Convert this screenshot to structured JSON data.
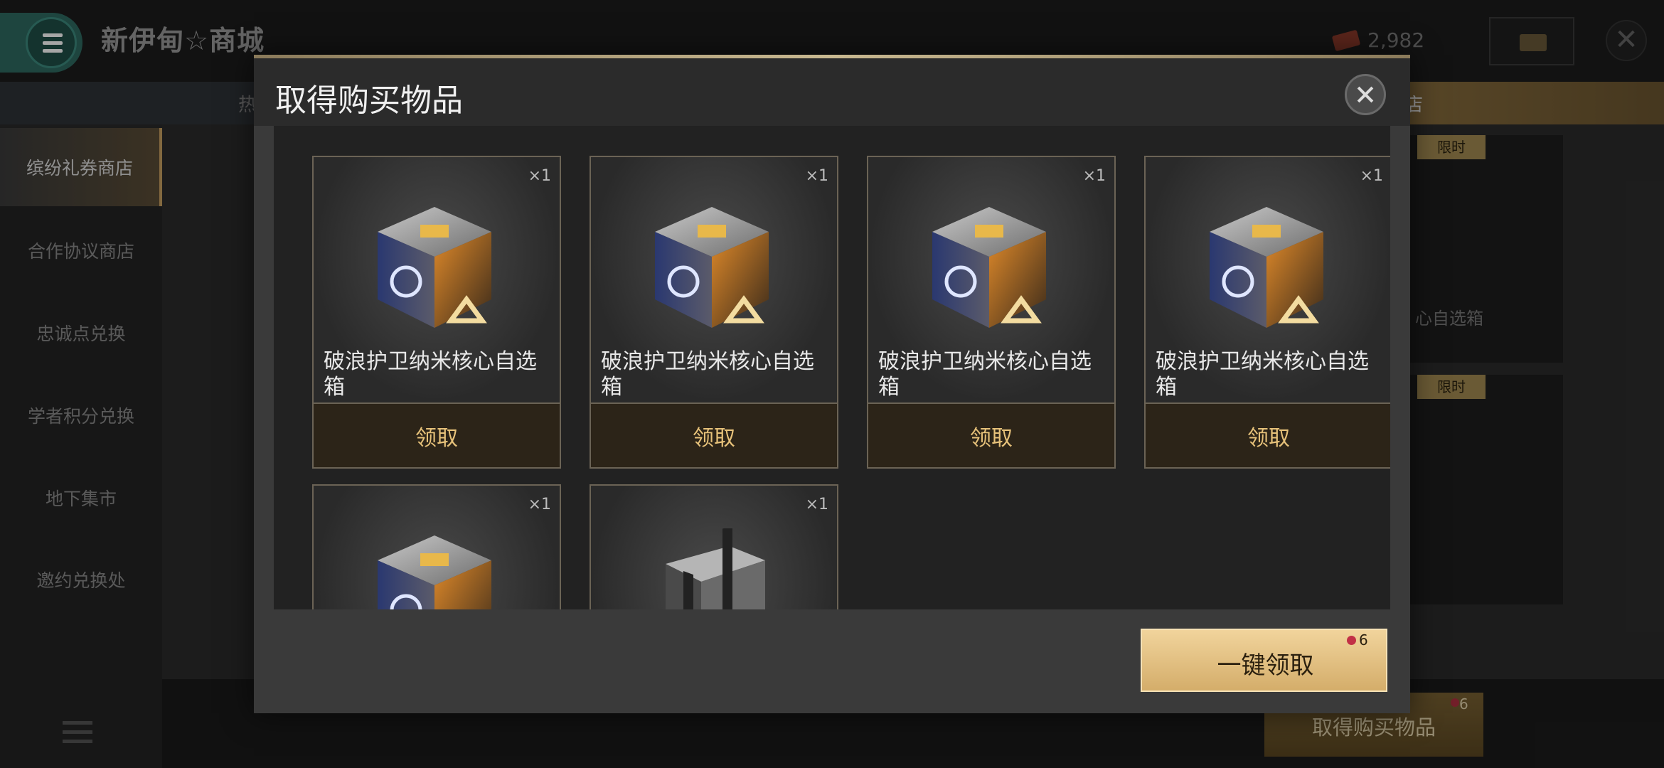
{
  "header": {
    "shop_title": "新伊甸☆商城",
    "currency_value": "2,982"
  },
  "tabs": {
    "hot_partial": "热",
    "right_partial": "店"
  },
  "sidebar": {
    "items": [
      {
        "label": "缤纷礼券商店",
        "active": true
      },
      {
        "label": "合作协议商店",
        "active": false
      },
      {
        "label": "忠诚点兑换",
        "active": false
      },
      {
        "label": "学者积分兑换",
        "active": false
      },
      {
        "label": "地下集市",
        "active": false
      },
      {
        "label": "邀约兑换处",
        "active": false
      }
    ]
  },
  "background": {
    "badge_1": "限时",
    "badge_2": "限时",
    "card_text_partial": "心自选箱",
    "bottom_button_label": "取得购买物品",
    "bottom_button_count": "6"
  },
  "modal": {
    "title": "取得购买物品",
    "items": [
      {
        "name": "破浪护卫纳米核心自选箱",
        "qty": "×1",
        "claim_label": "领取",
        "icon": "nano-core-cube-icon"
      },
      {
        "name": "破浪护卫纳米核心自选箱",
        "qty": "×1",
        "claim_label": "领取",
        "icon": "nano-core-cube-icon"
      },
      {
        "name": "破浪护卫纳米核心自选箱",
        "qty": "×1",
        "claim_label": "领取",
        "icon": "nano-core-cube-icon"
      },
      {
        "name": "破浪护卫纳米核心自选箱",
        "qty": "×1",
        "claim_label": "领取",
        "icon": "nano-core-cube-icon"
      },
      {
        "qty": "×1",
        "icon": "nano-core-cube-icon"
      },
      {
        "qty": "×1",
        "icon": "metal-crate-icon"
      }
    ],
    "claim_all_label": "一键领取",
    "claim_all_count": "6"
  },
  "colors": {
    "accent_gold": "#e7c27a",
    "claim_all_bg": "#e4c07e",
    "menu_teal": "#2e6b62",
    "badge_red": "#c23046"
  }
}
